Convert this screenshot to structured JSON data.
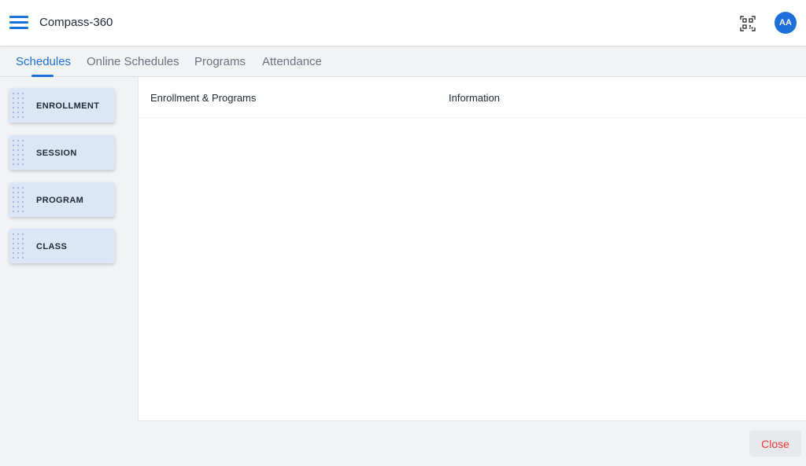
{
  "header": {
    "app_title": "Compass-360",
    "menu_icon": "hamburger-menu-icon",
    "qr_icon": "qr-code-scan-icon",
    "avatar_initials": "AA",
    "accent_color": "#1e6fd9"
  },
  "tabs": [
    {
      "label": "Schedules",
      "active": true
    },
    {
      "label": "Online Schedules",
      "active": false
    },
    {
      "label": "Programs",
      "active": false
    },
    {
      "label": "Attendance",
      "active": false
    }
  ],
  "sidebar": {
    "items": [
      {
        "label": "ENROLLMENT"
      },
      {
        "label": "SESSION"
      },
      {
        "label": "PROGRAM"
      },
      {
        "label": "CLASS"
      }
    ]
  },
  "main": {
    "columns": [
      "Enrollment & Programs",
      "Information"
    ]
  },
  "footer": {
    "close_label": "Close",
    "close_color": "#e53935"
  }
}
